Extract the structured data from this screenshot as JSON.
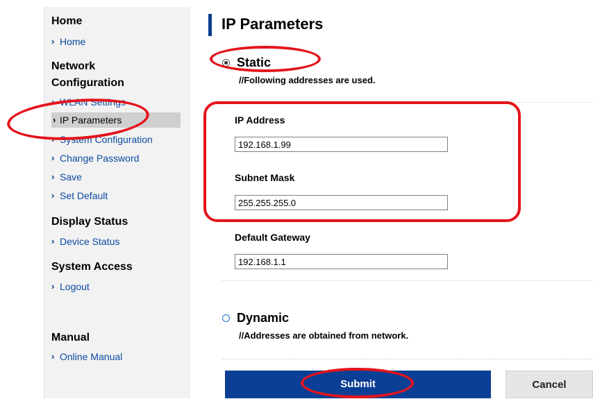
{
  "sidebar": {
    "home_title": "Home",
    "home_link": "Home",
    "network_title_line1": "Network",
    "network_title_line2": "Configuration",
    "network_items": [
      "WLAN Settings",
      "IP Parameters",
      "System Configuration",
      "Change Password",
      "Save",
      "Set Default"
    ],
    "display_title": "Display Status",
    "display_items": [
      "Device Status"
    ],
    "access_title": "System Access",
    "access_items": [
      "Logout"
    ],
    "manual_title": "Manual",
    "manual_items": [
      "Online Manual"
    ]
  },
  "main": {
    "title": "IP Parameters",
    "static_label": "Static",
    "static_note": "//Following addresses are used.",
    "ip_label": "IP Address",
    "ip_value": "192.168.1.99",
    "subnet_label": "Subnet Mask",
    "subnet_value": "255.255.255.0",
    "gateway_label": "Default Gateway",
    "gateway_value": "192.168.1.1",
    "dynamic_label": "Dynamic",
    "dynamic_note": "//Addresses are obtained from network.",
    "submit_label": "Submit",
    "cancel_label": "Cancel",
    "selected_mode": "Static"
  },
  "colors": {
    "accent_blue": "#0b3f95",
    "annotation_red": "#e4141b",
    "sidebar_bg": "#f2f2f2",
    "link_blue": "#0a4aa2"
  }
}
